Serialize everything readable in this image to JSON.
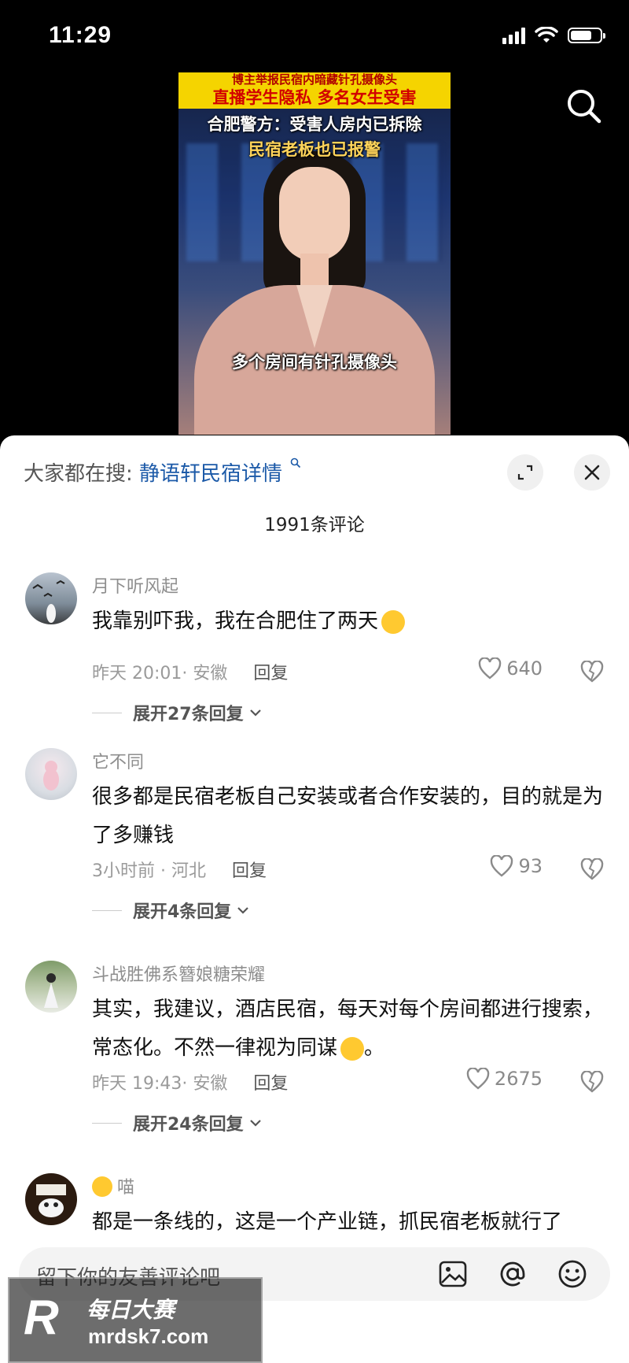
{
  "status_bar": {
    "time": "11:29"
  },
  "video": {
    "top_banner": "博主举报民宿内暗藏针孔摄像头",
    "headline_1": "直播学生隐私 多名女生受害",
    "headline_2": "合肥警方：受害人房内已拆除",
    "headline_3": "民宿老板也已报警",
    "subtitle": "多个房间有针孔摄像头"
  },
  "sheet": {
    "suggest_prefix": "大家都在搜:",
    "suggest_keyword": "静语轩民宿详情",
    "comment_count": "1991条评论"
  },
  "comments": [
    {
      "name": "月下听风起",
      "text": "我靠别吓我，我在合肥住了两天",
      "meta": "昨天 20:01· 安徽",
      "reply_label": "回复",
      "likes": "640",
      "expand": "展开27条回复"
    },
    {
      "name": "它不同",
      "text": "很多都是民宿老板自己安装或者合作安装的，目的就是为了多赚钱",
      "meta": "3小时前 · 河北",
      "reply_label": "回复",
      "likes": "93",
      "expand": "展开4条回复"
    },
    {
      "name": "斗战胜佛系簪娘糖荣耀",
      "text": "其实，我建议，酒店民宿，每天对每个房间都进行搜索，常态化。不然一律视为同谋",
      "text_tail": "。",
      "meta": "昨天 19:43· 安徽",
      "reply_label": "回复",
      "likes": "2675",
      "expand": "展开24条回复"
    },
    {
      "name": "喵",
      "text": "都是一条线的，这是一个产业链，抓民宿老板就行了"
    }
  ],
  "input": {
    "placeholder": "留下你的友善评论吧"
  },
  "watermark": {
    "letter": "R",
    "brand": "每日大赛",
    "url": "mrdsk7.com"
  },
  "colors": {
    "accent_link": "#1c5aa8",
    "headline_yellow": "#f5d400",
    "headline_red": "#d20000"
  }
}
